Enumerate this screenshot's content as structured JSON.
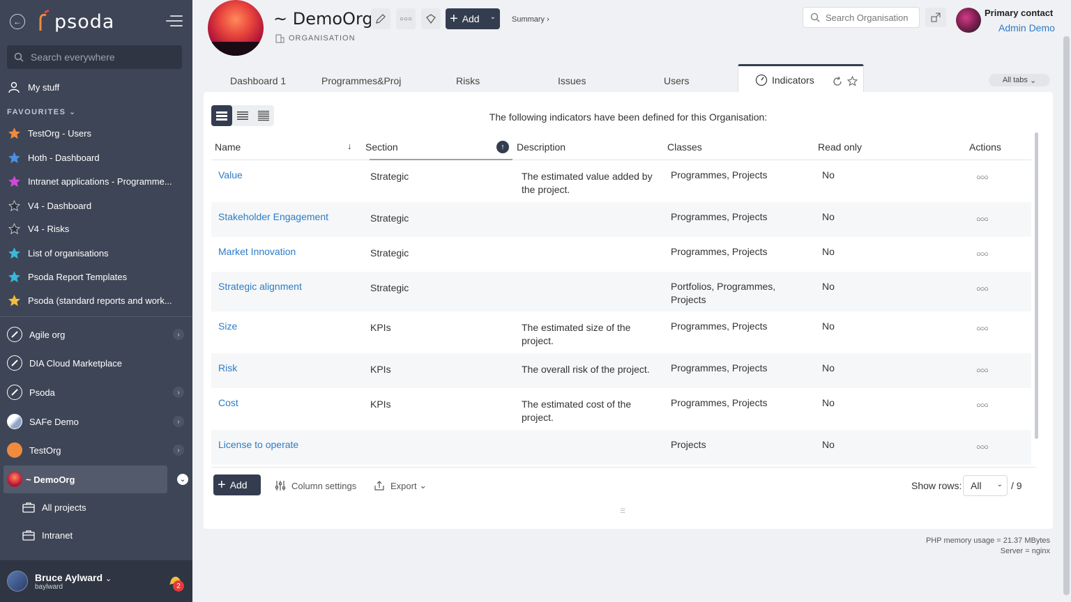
{
  "sidebar": {
    "logo": "psoda",
    "search_placeholder": "Search everywhere",
    "my_stuff": "My stuff",
    "favourites_title": "FAVOURITES",
    "favourites": [
      {
        "label": "TestOrg - Users",
        "color": "#f08a3c"
      },
      {
        "label": "Hoth - Dashboard",
        "color": "#4a90e2"
      },
      {
        "label": "Intranet applications - Programme...",
        "color": "#d04ad8"
      },
      {
        "label": "V4 - Dashboard",
        "color": "#2b2f38"
      },
      {
        "label": "V4 - Risks",
        "color": "#2b2f38"
      },
      {
        "label": "List of organisations",
        "color": "#3ab8d8"
      },
      {
        "label": "Psoda Report Templates",
        "color": "#3ab8d8"
      },
      {
        "label": "Psoda (standard reports and work...",
        "color": "#f0c03c"
      }
    ],
    "orgs": [
      {
        "label": "Agile org",
        "chevron": true
      },
      {
        "label": "DIA Cloud Marketplace",
        "chevron": false
      },
      {
        "label": "Psoda",
        "chevron": true
      },
      {
        "label": "SAFe Demo",
        "chevron": true
      },
      {
        "label": "TestOrg",
        "chevron": true
      },
      {
        "label": "~ DemoOrg",
        "chevron": true
      }
    ],
    "sub_items": [
      "All projects",
      "Intranet"
    ],
    "user": {
      "name": "Bruce Aylward",
      "login": "baylward",
      "notifications": "2"
    }
  },
  "header": {
    "title": "~ DemoOrg",
    "subtitle": "ORGANISATION",
    "add_label": "Add",
    "breadcrumb": "Summary ›",
    "search_placeholder": "Search Organisation",
    "primary_contact_label": "Primary contact",
    "primary_contact_name": "Admin Demo"
  },
  "tabs": {
    "items": [
      "Dashboard 1",
      "Programmes&Proj",
      "Risks",
      "Issues",
      "Users"
    ],
    "active": "Indicators",
    "all_tabs": "All tabs"
  },
  "panel": {
    "intro": "The following indicators have been defined for this Organisation:",
    "columns": [
      "Name",
      "Section",
      "Description",
      "Classes",
      "Read only",
      "Actions"
    ],
    "rows": [
      {
        "name": "Value",
        "section": "Strategic",
        "description": "The estimated value added by the project.",
        "classes": "Programmes, Projects",
        "read_only": "No"
      },
      {
        "name": "Stakeholder Engagement",
        "section": "Strategic",
        "description": "",
        "classes": "Programmes, Projects",
        "read_only": "No"
      },
      {
        "name": "Market Innovation",
        "section": "Strategic",
        "description": "",
        "classes": "Programmes, Projects",
        "read_only": "No"
      },
      {
        "name": "Strategic alignment",
        "section": "Strategic",
        "description": "",
        "classes": "Portfolios, Programmes, Projects",
        "read_only": "No"
      },
      {
        "name": "Size",
        "section": "KPIs",
        "description": "The estimated size of the project.",
        "classes": "Programmes, Projects",
        "read_only": "No"
      },
      {
        "name": "Risk",
        "section": "KPIs",
        "description": "The overall risk of the project.",
        "classes": "Programmes, Projects",
        "read_only": "No"
      },
      {
        "name": "Cost",
        "section": "KPIs",
        "description": "The estimated cost of the project.",
        "classes": "Programmes, Projects",
        "read_only": "No"
      },
      {
        "name": "License to operate",
        "section": "",
        "description": "",
        "classes": "Projects",
        "read_only": "No"
      }
    ],
    "footer": {
      "add_label": "Add",
      "column_settings": "Column settings",
      "export": "Export",
      "show_rows_label": "Show rows:",
      "show_rows_value": "All",
      "total": "/ 9"
    }
  },
  "footer_info": {
    "memory": "PHP memory usage = 21.37 MBytes",
    "server": "Server = nginx"
  }
}
